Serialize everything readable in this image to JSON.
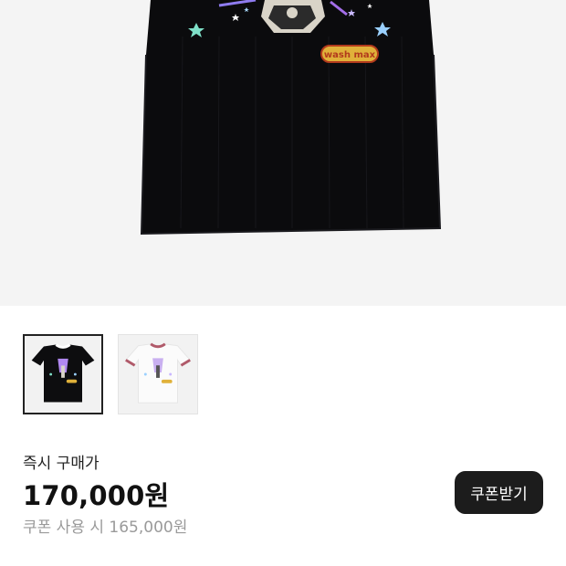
{
  "product": {
    "sticker_text": "wash max",
    "thumbnails": [
      {
        "name": "black-tee",
        "selected": true
      },
      {
        "name": "white-tee",
        "selected": false
      }
    ]
  },
  "price": {
    "label": "즉시 구매가",
    "amount": "170,000원",
    "coupon_price": "쿠폰 사용 시 165,000원"
  },
  "coupon_button": {
    "label": "쿠폰받기"
  }
}
